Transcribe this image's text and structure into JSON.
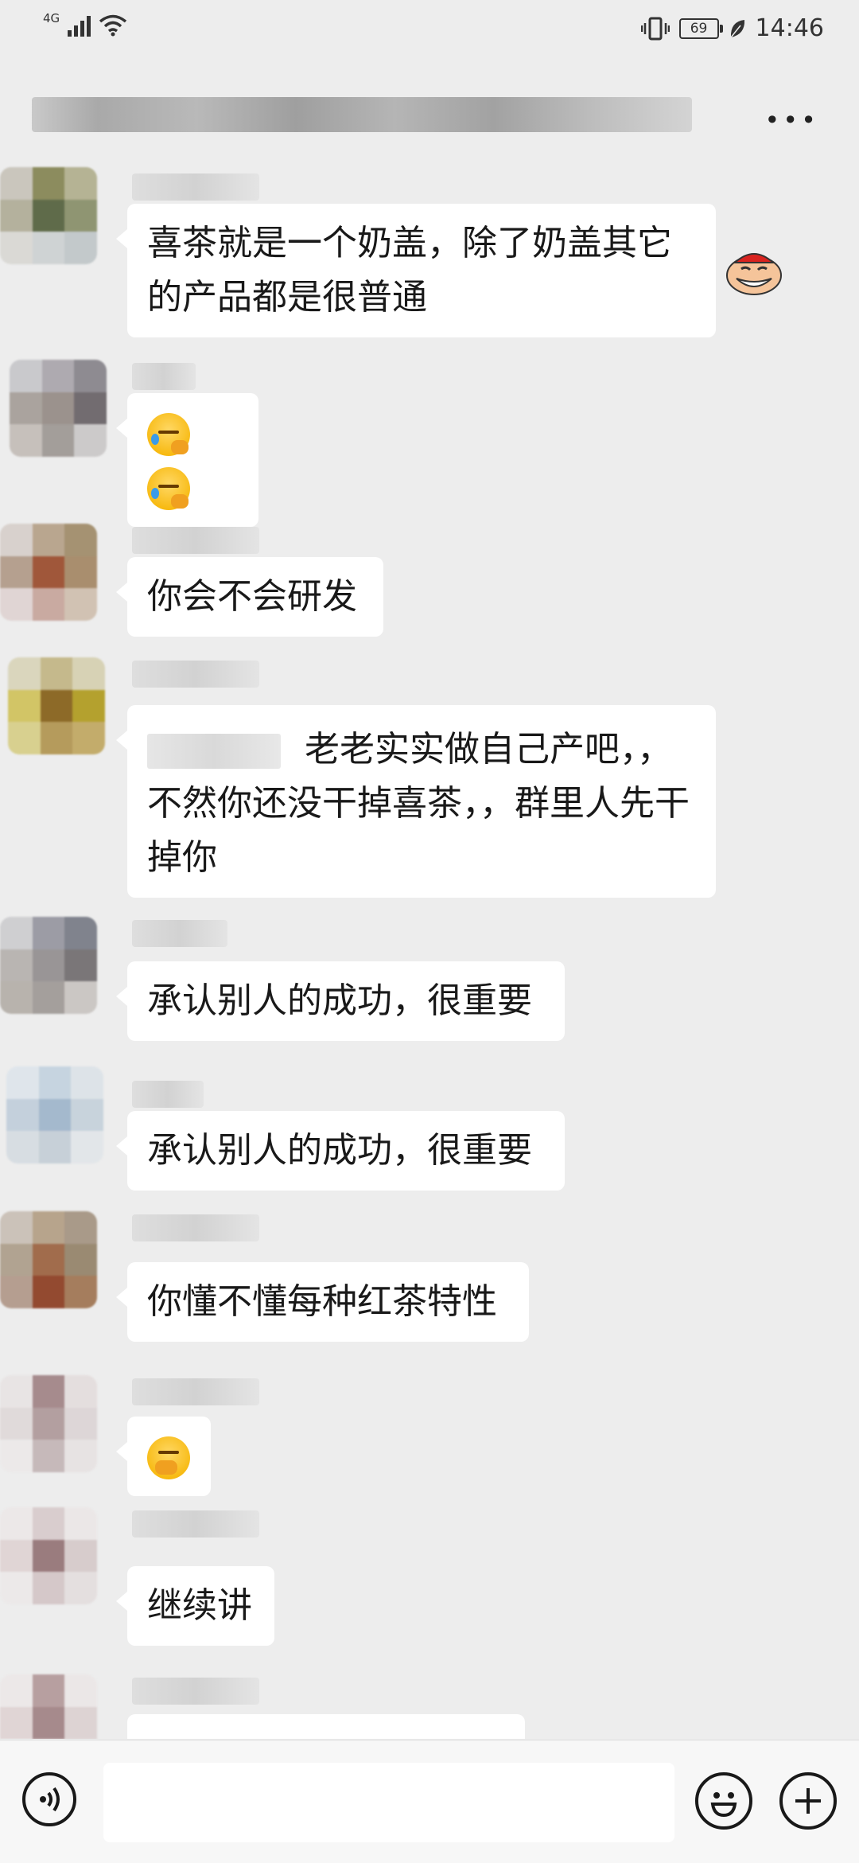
{
  "status_bar": {
    "network": "4G",
    "battery": "69",
    "time": "14:46"
  },
  "header": {
    "more_label": "•••"
  },
  "messages": [
    {
      "text": "喜茶就是一个奶盖，除了奶盖其它的产品都是很普通"
    },
    {
      "text": "😭😭",
      "emoji_names": [
        "crying-facepalm-emoji",
        "crying-facepalm-emoji"
      ]
    },
    {
      "text": "你会不会研发"
    },
    {
      "text": "老老实实做自己产吧，，不然你还没干掉喜茶，，群里人先干掉你"
    },
    {
      "text": "承认别人的成功，很重要"
    },
    {
      "text": "承认别人的成功，很重要"
    },
    {
      "text": "你懂不懂每种红茶特性"
    },
    {
      "text": "🤭",
      "emoji_names": [
        "hand-over-mouth-emoji"
      ]
    },
    {
      "text": "继续讲"
    }
  ],
  "icons": {
    "voice": "voice-icon",
    "emoji": "emoji-icon",
    "plus": "plus-icon",
    "more": "more-icon",
    "sticker": "laughing-sticker"
  }
}
